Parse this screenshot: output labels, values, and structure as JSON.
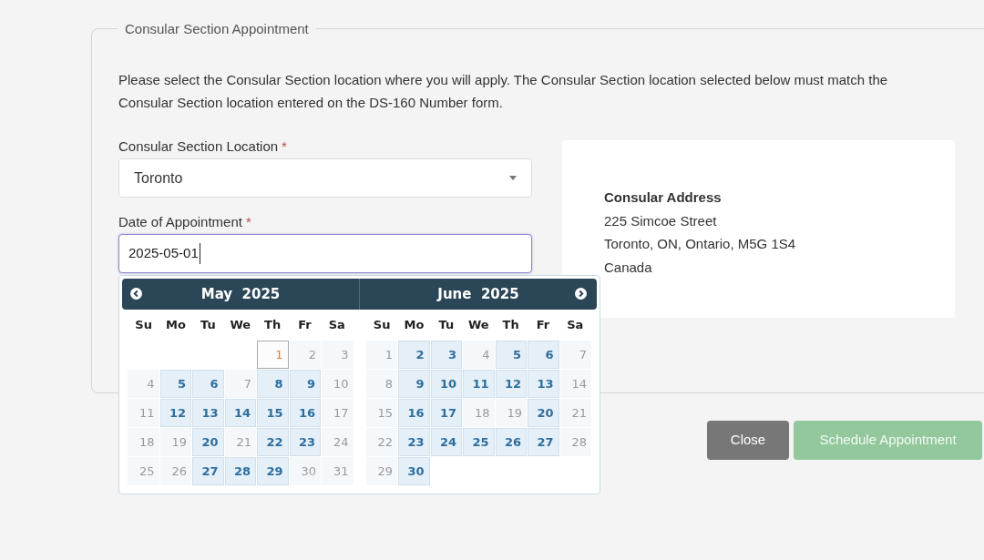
{
  "fieldset": {
    "legend": "Consular Section Appointment",
    "instructions": "Please select the Consular Section location where you will apply. The Consular Section location selected below must match the Consular Section location entered on the DS-160 Number form."
  },
  "location": {
    "label": "Consular Section Location",
    "required_mark": "*",
    "value": "Toronto"
  },
  "date": {
    "label": "Date of Appointment",
    "required_mark": "*",
    "value": "2025-05-01"
  },
  "address": {
    "title": "Consular Address",
    "lines": [
      "225 Simcoe Street",
      "Toronto, ON, Ontario, M5G 1S4",
      "Canada"
    ]
  },
  "calendar": {
    "months": [
      {
        "title": "May  2025",
        "weekdays": [
          "Su",
          "Mo",
          "Tu",
          "We",
          "Th",
          "Fr",
          "Sa"
        ],
        "weeks": [
          [
            {
              "day": "1",
              "available": false,
              "selected": true
            },
            {
              "day": "2",
              "available": false,
              "selected": false
            },
            {
              "day": "3",
              "available": false,
              "selected": false
            }
          ],
          [
            {
              "day": "4",
              "available": false,
              "selected": false
            },
            {
              "day": "5",
              "available": true,
              "selected": false
            },
            {
              "day": "6",
              "available": true,
              "selected": false
            },
            {
              "day": "7",
              "available": false,
              "selected": false
            },
            {
              "day": "8",
              "available": true,
              "selected": false
            },
            {
              "day": "9",
              "available": true,
              "selected": false
            },
            {
              "day": "10",
              "available": false,
              "selected": false
            }
          ],
          [
            {
              "day": "11",
              "available": false,
              "selected": false
            },
            {
              "day": "12",
              "available": true,
              "selected": false
            },
            {
              "day": "13",
              "available": true,
              "selected": false
            },
            {
              "day": "14",
              "available": true,
              "selected": false
            },
            {
              "day": "15",
              "available": true,
              "selected": false
            },
            {
              "day": "16",
              "available": true,
              "selected": false
            },
            {
              "day": "17",
              "available": false,
              "selected": false
            }
          ],
          [
            {
              "day": "18",
              "available": false,
              "selected": false
            },
            {
              "day": "19",
              "available": false,
              "selected": false
            },
            {
              "day": "20",
              "available": true,
              "selected": false
            },
            {
              "day": "21",
              "available": false,
              "selected": false
            },
            {
              "day": "22",
              "available": true,
              "selected": false
            },
            {
              "day": "23",
              "available": true,
              "selected": false
            },
            {
              "day": "24",
              "available": false,
              "selected": false
            }
          ],
          [
            {
              "day": "25",
              "available": false,
              "selected": false
            },
            {
              "day": "26",
              "available": false,
              "selected": false
            },
            {
              "day": "27",
              "available": true,
              "selected": false
            },
            {
              "day": "28",
              "available": true,
              "selected": false
            },
            {
              "day": "29",
              "available": true,
              "selected": false
            },
            {
              "day": "30",
              "available": false,
              "selected": false
            },
            {
              "day": "31",
              "available": false,
              "selected": false
            }
          ]
        ]
      },
      {
        "title": "June  2025",
        "weekdays": [
          "Su",
          "Mo",
          "Tu",
          "We",
          "Th",
          "Fr",
          "Sa"
        ],
        "weeks": [
          [
            {
              "day": "1",
              "available": false,
              "selected": false
            },
            {
              "day": "2",
              "available": true,
              "selected": false
            },
            {
              "day": "3",
              "available": true,
              "selected": false
            },
            {
              "day": "4",
              "available": false,
              "selected": false
            },
            {
              "day": "5",
              "available": true,
              "selected": false
            },
            {
              "day": "6",
              "available": true,
              "selected": false
            },
            {
              "day": "7",
              "available": false,
              "selected": false
            }
          ],
          [
            {
              "day": "8",
              "available": false,
              "selected": false
            },
            {
              "day": "9",
              "available": true,
              "selected": false
            },
            {
              "day": "10",
              "available": true,
              "selected": false
            },
            {
              "day": "11",
              "available": true,
              "selected": false
            },
            {
              "day": "12",
              "available": true,
              "selected": false
            },
            {
              "day": "13",
              "available": true,
              "selected": false
            },
            {
              "day": "14",
              "available": false,
              "selected": false
            }
          ],
          [
            {
              "day": "15",
              "available": false,
              "selected": false
            },
            {
              "day": "16",
              "available": true,
              "selected": false
            },
            {
              "day": "17",
              "available": true,
              "selected": false
            },
            {
              "day": "18",
              "available": false,
              "selected": false
            },
            {
              "day": "19",
              "available": false,
              "selected": false
            },
            {
              "day": "20",
              "available": true,
              "selected": false
            },
            {
              "day": "21",
              "available": false,
              "selected": false
            }
          ],
          [
            {
              "day": "22",
              "available": false,
              "selected": false
            },
            {
              "day": "23",
              "available": true,
              "selected": false
            },
            {
              "day": "24",
              "available": true,
              "selected": false
            },
            {
              "day": "25",
              "available": true,
              "selected": false
            },
            {
              "day": "26",
              "available": true,
              "selected": false
            },
            {
              "day": "27",
              "available": true,
              "selected": false
            },
            {
              "day": "28",
              "available": false,
              "selected": false
            }
          ],
          [
            {
              "day": "29",
              "available": false,
              "selected": false
            },
            {
              "day": "30",
              "available": true,
              "selected": false
            }
          ]
        ]
      }
    ]
  },
  "buttons": [
    {
      "label": "Close",
      "kind": "secondary",
      "disabled": false
    },
    {
      "label": "Schedule Appointment",
      "kind": "primary",
      "disabled": true
    }
  ]
}
